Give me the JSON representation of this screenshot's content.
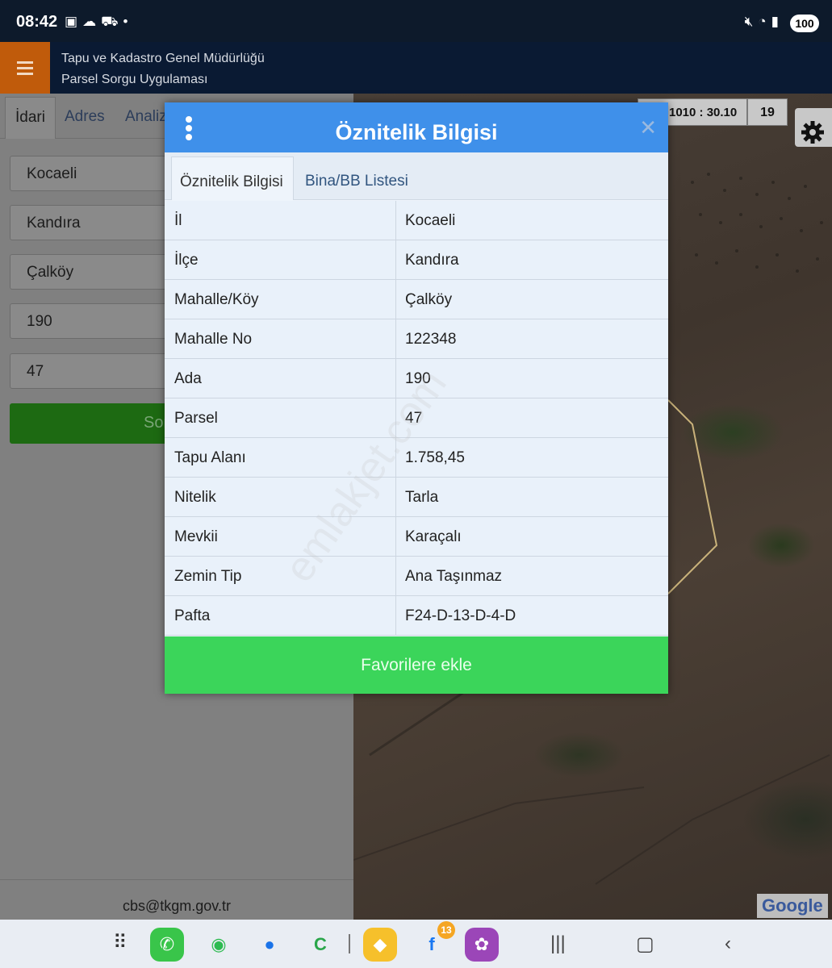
{
  "status_bar": {
    "time": "08:42",
    "left_icons": [
      "screenshot-icon",
      "cloud-icon",
      "car-icon",
      "dot-icon"
    ],
    "right_icons": [
      "mute-icon",
      "wifi-icon",
      "signal-icon"
    ],
    "battery": "100"
  },
  "app": {
    "title_line1": "Tapu ve Kadastro Genel Müdürlüğü",
    "title_line2": "Parsel Sorgu Uygulaması",
    "accent_color": "#c05b0b"
  },
  "left_panel": {
    "tabs": [
      {
        "label": "İdari",
        "active": true
      },
      {
        "label": "Adres",
        "active": false
      },
      {
        "label": "Analiz",
        "active": false
      }
    ],
    "fields": [
      {
        "value": "Kocaeli"
      },
      {
        "value": "Kandıra"
      },
      {
        "value": "Çalköy"
      },
      {
        "value": "190"
      },
      {
        "value": "47"
      }
    ],
    "search_label": "Sorgula",
    "footer_email": "cbs@tkgm.gov.tr"
  },
  "map": {
    "scale": "1010 : 30.10",
    "zoom": "19",
    "attribution": "Google",
    "watermark": "emlakjet.com"
  },
  "modal": {
    "title": "Öznitelik Bilgisi",
    "tabs": [
      {
        "label": "Öznitelik Bilgisi",
        "active": true
      },
      {
        "label": "Bina/BB Listesi",
        "active": false
      }
    ],
    "rows": [
      {
        "key": "İl",
        "value": "Kocaeli"
      },
      {
        "key": "İlçe",
        "value": "Kandıra"
      },
      {
        "key": "Mahalle/Köy",
        "value": "Çalköy"
      },
      {
        "key": "Mahalle No",
        "value": "122348"
      },
      {
        "key": "Ada",
        "value": "190"
      },
      {
        "key": "Parsel",
        "value": "47"
      },
      {
        "key": "Tapu Alanı",
        "value": "1.758,45"
      },
      {
        "key": "Nitelik",
        "value": "Tarla"
      },
      {
        "key": "Mevkii",
        "value": "Karaçalı"
      },
      {
        "key": "Zemin Tip",
        "value": "Ana Taşınmaz"
      },
      {
        "key": "Pafta",
        "value": "F24-D-13-D-4-D"
      }
    ],
    "favorite_label": "Favorilere ekle",
    "header_color": "#3f90ea",
    "button_color": "#3bd55a"
  },
  "nav_bar": {
    "apps": [
      "apps-grid-icon",
      "phone-icon",
      "whatsapp-icon",
      "messages-icon",
      "c-app-icon",
      "sahibinden-icon",
      "facebook-icon",
      "gallery-app-icon"
    ],
    "facebook_badge": "13",
    "system": [
      "recents-icon",
      "home-icon",
      "back-icon"
    ]
  }
}
